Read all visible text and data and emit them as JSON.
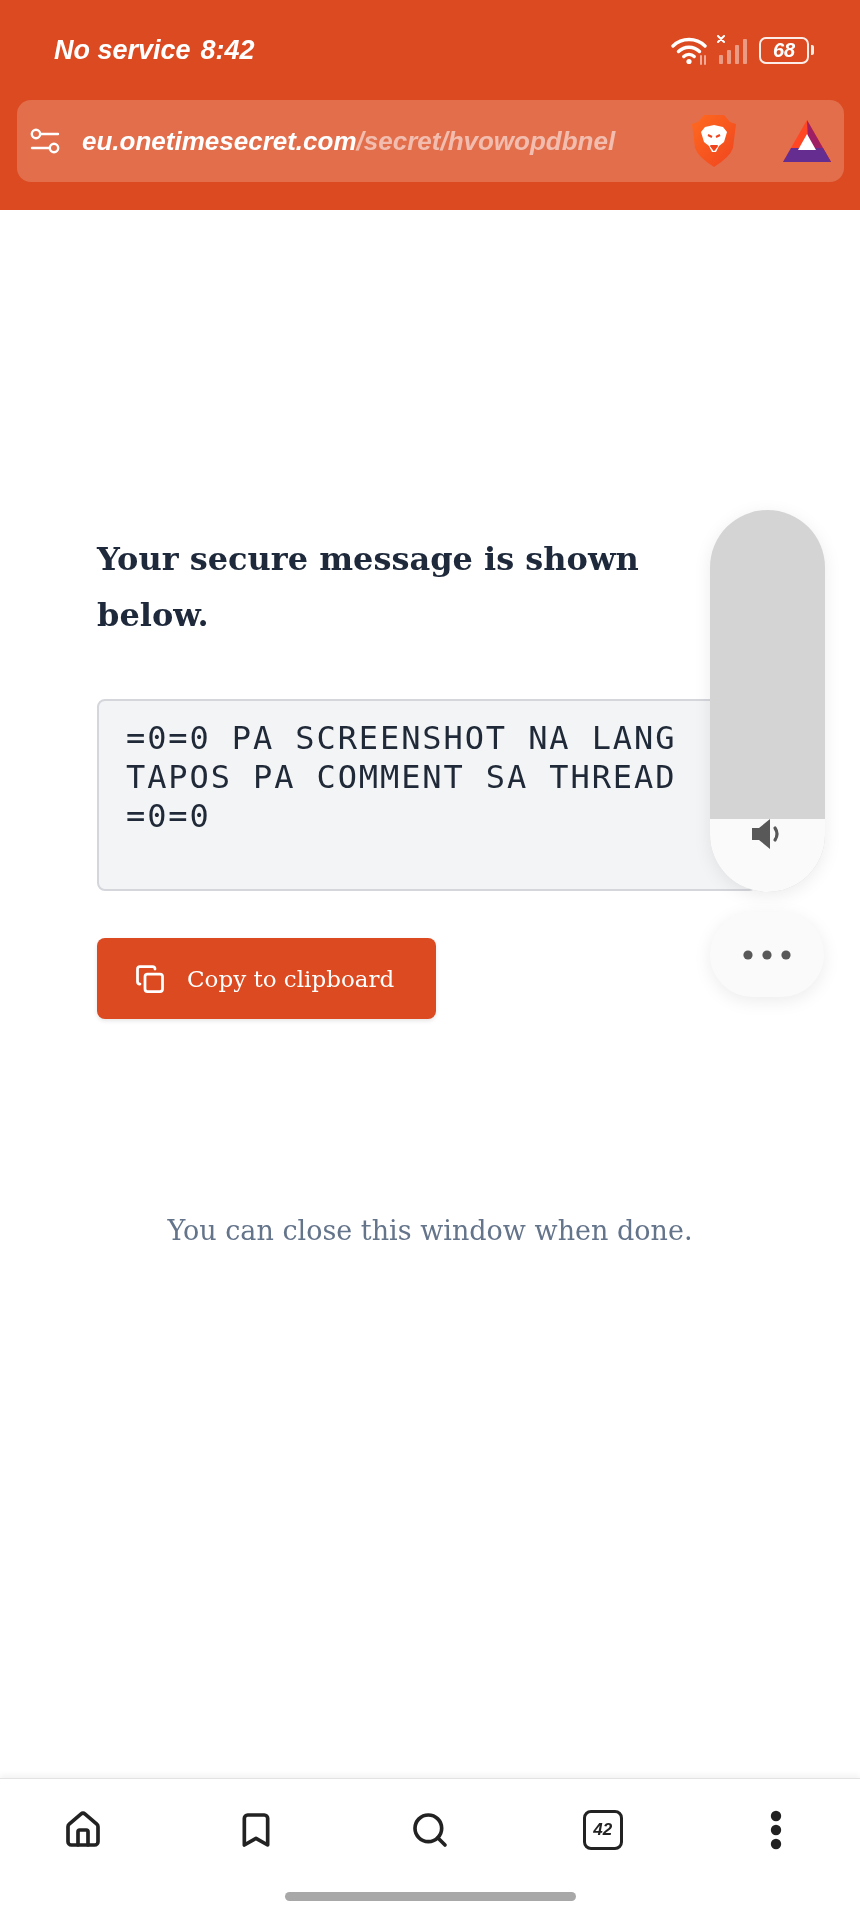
{
  "status_bar": {
    "carrier": "No service",
    "time": "8:42",
    "battery": "68"
  },
  "address_bar": {
    "domain": "eu.onetimesecret.com",
    "path": "/secret/hvowopdbnel"
  },
  "content": {
    "heading": "Your secure message is shown below.",
    "message": "=0=0 PA SCREENSHOT NA LANG TAPOS PA COMMENT SA THREAD =0=0",
    "copy_button": "Copy to clipboard",
    "note": "You can close this window when done."
  },
  "volume_panel": {
    "level": 0.19
  },
  "bottom_nav": {
    "tab_count": "42"
  }
}
